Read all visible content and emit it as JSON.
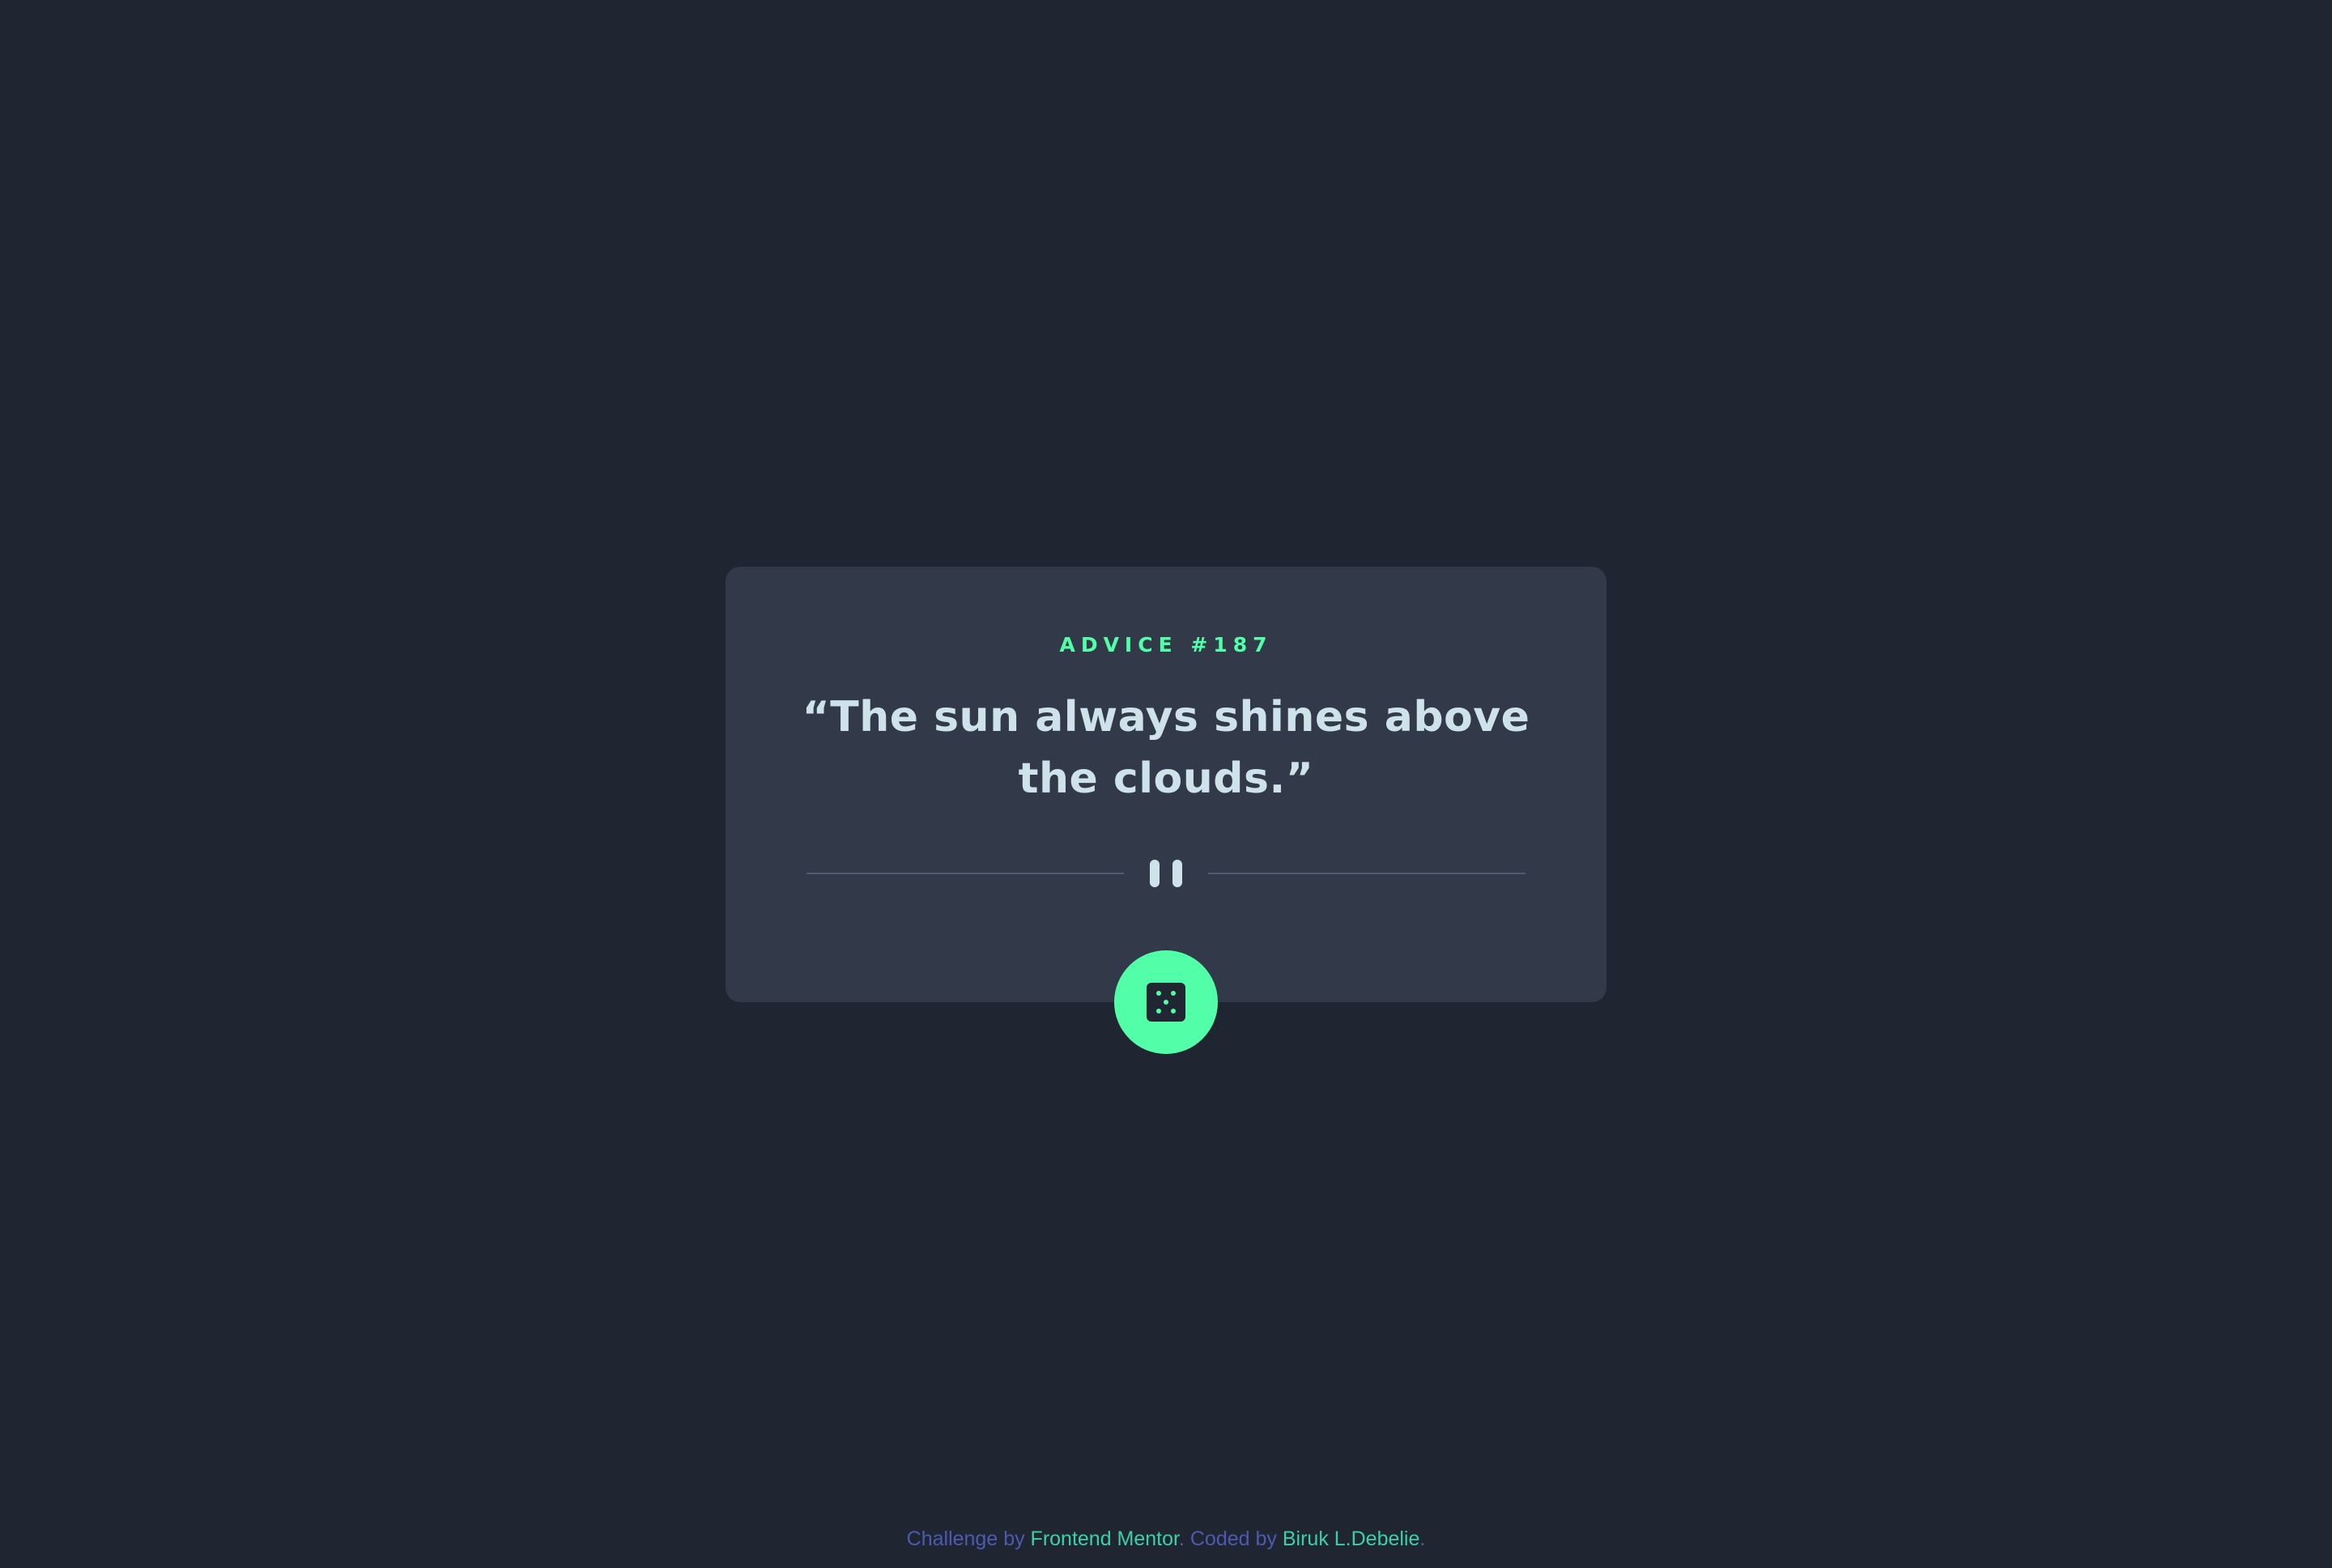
{
  "advice": {
    "label": "ADVICE #187",
    "quote": "“The sun always shines above the clouds.”"
  },
  "divider": {
    "icon": "pause-icon"
  },
  "button": {
    "icon": "dice-icon",
    "color": "#52ffa8"
  },
  "footer": {
    "challenge_prefix": "Challenge by",
    "challenge_link": "Frontend Mentor",
    "coded_prefix": ". Coded by",
    "coded_link": "Biruk L.Debelie",
    "suffix": "."
  },
  "colors": {
    "background": "#1f2632",
    "card": "#323a49",
    "accent": "#52ffa8",
    "quote_text": "#cee3e9",
    "footer_text": "#4e5ab0",
    "footer_link": "#3ecfa7"
  }
}
